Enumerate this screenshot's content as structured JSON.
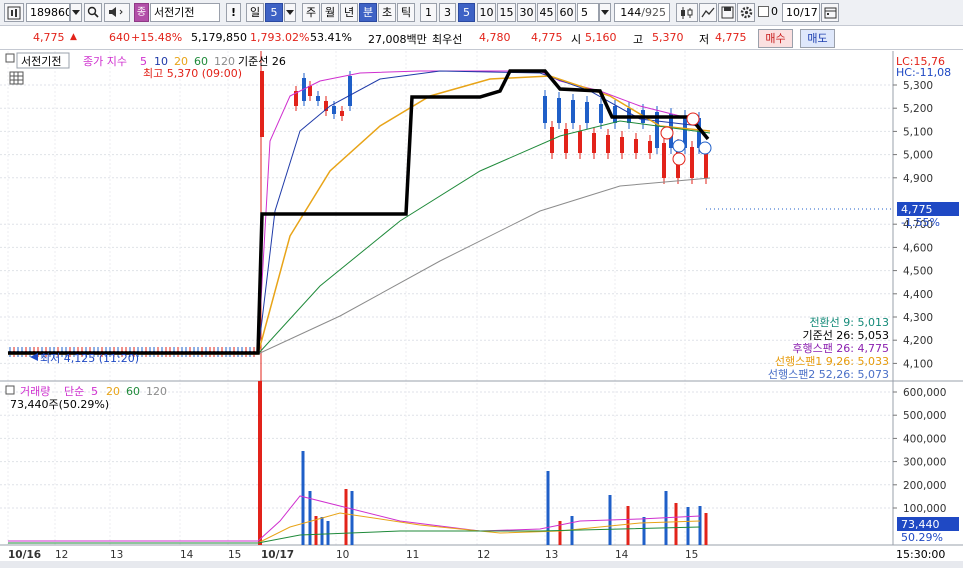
{
  "toolbar": {
    "code": "189860",
    "name": "서전기전",
    "period_buttons": [
      "일",
      "5"
    ],
    "timeframes": [
      "주",
      "월",
      "년",
      "분",
      "초",
      "틱"
    ],
    "minutes": [
      "1",
      "3",
      "5",
      "10",
      "15",
      "30",
      "45",
      "60"
    ],
    "interval_value": "5",
    "count": "144",
    "count_total": "/925",
    "zero_label": "0",
    "date": "10/17",
    "exclaim": "!"
  },
  "infobar": {
    "price": "4,775",
    "arrow": "▲",
    "change": "640",
    "change_pct": "+15.48%",
    "volume": "5,179,850",
    "volume_ratio": "1,793.02%",
    "turnover": "53.41%",
    "trade_value": "27,008백만",
    "best_ask_label": "최우선",
    "best_ask": "4,780",
    "best_bid": "4,775",
    "open_label": "시",
    "open": "5,160",
    "high_label": "고",
    "high": "5,370",
    "low_label": "저",
    "low": "4,775",
    "buy_button": "매수",
    "sell_button": "매도"
  },
  "price_pane": {
    "title": "서전기전",
    "legend_prefix": "종가 지수",
    "ma_periods": [
      "5",
      "10",
      "20",
      "60",
      "120"
    ],
    "ichimoku_label": "기준선 26",
    "high_note": "최고 5,370 (09:00)",
    "low_note": "최저 4,125 (11:20)",
    "lc": "LC:15,76",
    "hc": "HC:-11,08",
    "current_price": "4,775",
    "current_pct": "-1.55%",
    "price_ticks": [
      "5,300",
      "5,200",
      "5,100",
      "5,000",
      "4,900",
      "4,700",
      "4,600",
      "4,500",
      "4,400",
      "4,300",
      "4,200",
      "4,100"
    ],
    "ichimoku_values": [
      {
        "label": "전환선 9: 5,013",
        "color": "#138a78"
      },
      {
        "label": "기준선 26: 5,053",
        "color": "#000000"
      },
      {
        "label": "후행스팬 26: 4,775",
        "color": "#8b1fb0"
      },
      {
        "label": "선행스팬1 9,26: 5,033",
        "color": "#e69a0a"
      },
      {
        "label": "선행스팬2 52,26: 5,073",
        "color": "#4a6fc7"
      }
    ]
  },
  "volume_pane": {
    "title": "거래량",
    "legend_prefix": "단순",
    "ma_periods": [
      "5",
      "20",
      "60",
      "120"
    ],
    "volume_note": "73,440주(50.29%)",
    "volume_ticks": [
      "600,000",
      "500,000",
      "400,000",
      "300,000",
      "200,000",
      "100,000"
    ],
    "current_volume": "73,440",
    "current_volume_pct": "50.29%"
  },
  "time_axis": {
    "labels": [
      "10/16",
      "12",
      "13",
      "14",
      "15",
      "10/17",
      "10",
      "11",
      "12",
      "13",
      "14",
      "15"
    ],
    "clock": "15:30:00"
  },
  "colors": {
    "up": "#e2231a",
    "down": "#1f5fc8",
    "ma5": "#cf2fcf",
    "ma10": "#1f3aa8",
    "ma20": "#e8a418",
    "ma60": "#1f8a3a",
    "ma120": "#8c8c8c",
    "kijun": "#000000"
  },
  "icons": [
    "chart-type-icon",
    "dropdown-icon",
    "search-icon",
    "speaker-icon",
    "related-icon",
    "alert-icon",
    "candle-icon",
    "draw-icon",
    "save-icon",
    "settings-icon",
    "calendar-icon"
  ]
}
